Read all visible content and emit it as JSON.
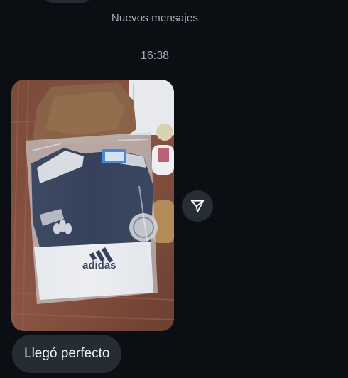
{
  "divider": {
    "label": "Nuevos mensajes"
  },
  "timestamp": "16:38",
  "messages": [
    {
      "type": "photo",
      "image_content": {
        "brand_text": "adidas",
        "description_icon": "package-photo"
      }
    },
    {
      "type": "text",
      "text": "Llegó perfecto"
    }
  ],
  "share_button": {
    "icon": "paper-plane-icon"
  },
  "colors": {
    "background": "#0b0f14",
    "bubble": "#262c33",
    "secondary_text": "#a7adb4",
    "primary_text": "#f2f4f6"
  }
}
